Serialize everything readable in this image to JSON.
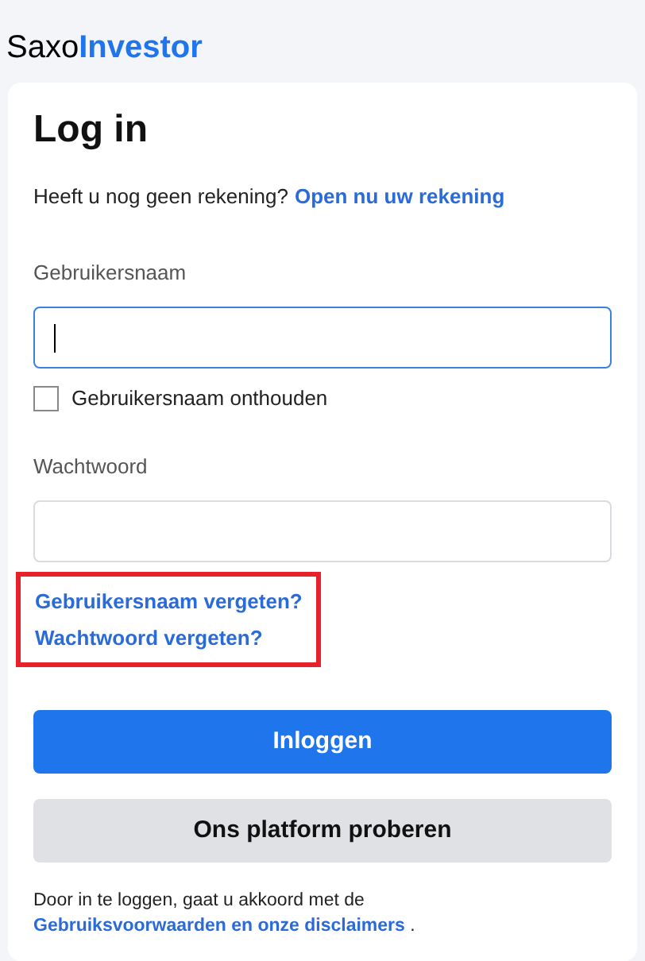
{
  "logo": {
    "part_1": "Saxo",
    "part_2": "Investor"
  },
  "title": "Log in",
  "signup": {
    "text": "Heeft u nog geen rekening?",
    "link": "Open nu uw rekening"
  },
  "username": {
    "label": "Gebruikersnaam",
    "focused": true
  },
  "remember": {
    "label": "Gebruikersnaam onthouden",
    "checked": false
  },
  "password": {
    "label": "Wachtwoord",
    "focused": false
  },
  "forgot": {
    "highlighted": true,
    "links": [
      "Gebruikersnaam vergeten?",
      "Wachtwoord vergeten?"
    ]
  },
  "buttons": [
    {
      "label": "Inloggen",
      "kind": "primary"
    },
    {
      "label": "Ons platform proberen",
      "kind": "secondary"
    }
  ],
  "footer": {
    "text": "Door in te loggen, gaat u akkoord met de",
    "link": "Gebruiksvoorwaarden en onze disclaimers",
    "end": "."
  }
}
